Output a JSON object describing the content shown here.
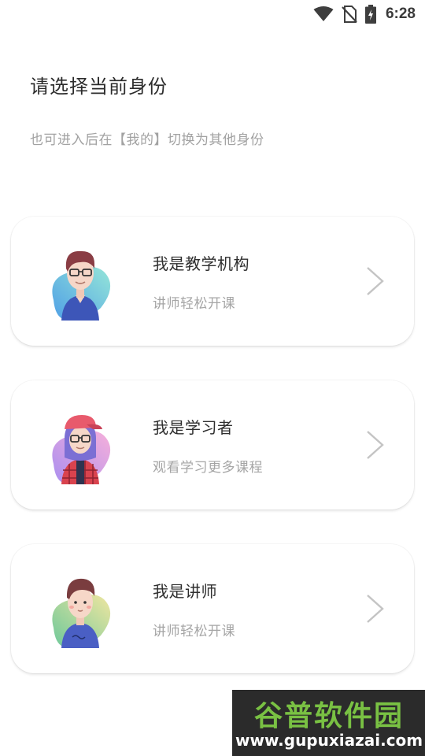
{
  "status_bar": {
    "time": "6:28",
    "icons": [
      "wifi-icon",
      "no-sim-icon",
      "battery-charging-icon"
    ]
  },
  "header": {
    "title": "请选择当前身份",
    "subtitle": "也可进入后在【我的】切换为其他身份"
  },
  "roles": [
    {
      "title": "我是教学机构",
      "description": "讲师轻松开课",
      "avatar": "institution-avatar-icon",
      "colors": [
        "#5aa8e8",
        "#8fe0d6"
      ]
    },
    {
      "title": "我是学习者",
      "description": "观看学习更多课程",
      "avatar": "learner-avatar-icon",
      "colors": [
        "#b79af0",
        "#f3a8d8"
      ]
    },
    {
      "title": "我是讲师",
      "description": "讲师轻松开课",
      "avatar": "lecturer-avatar-icon",
      "colors": [
        "#7dd0a0",
        "#ece49a"
      ]
    }
  ],
  "watermark": {
    "name": "谷普软件园",
    "url": "www.gupuxiazai.com"
  }
}
